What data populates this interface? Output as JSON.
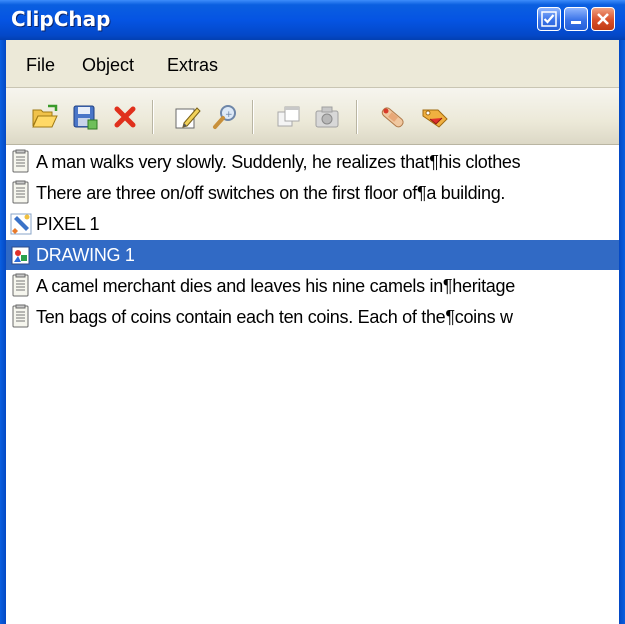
{
  "window": {
    "title": "ClipChap",
    "buttons": [
      {
        "name": "help",
        "icon": "checkmark-icon"
      },
      {
        "name": "minimize",
        "icon": "minimize-icon"
      },
      {
        "name": "close",
        "icon": "close-icon"
      }
    ]
  },
  "menu": [
    "File",
    "Object",
    "Extras"
  ],
  "toolbar": {
    "tools": [
      {
        "name": "open",
        "icon": "folder-open-icon"
      },
      {
        "name": "save",
        "icon": "floppy-save-icon"
      },
      {
        "name": "delete",
        "icon": "red-x-delete-icon"
      },
      {
        "name": "edit",
        "icon": "pencil-edit-icon"
      },
      {
        "name": "find",
        "icon": "magnifier-icon"
      },
      {
        "name": "copy",
        "icon": "copy-windows-icon"
      },
      {
        "name": "camera",
        "icon": "camera-icon"
      },
      {
        "name": "patch",
        "icon": "bandage-icon"
      },
      {
        "name": "tag",
        "icon": "tag-icon"
      }
    ]
  },
  "list": {
    "items": [
      {
        "text": "A man walks very slowly. Suddenly, he realizes that¶his clothes",
        "icon": "text-note-icon",
        "selected": false
      },
      {
        "text": "There are three on/off switches on the first floor of¶a building.",
        "icon": "text-note-icon",
        "selected": false
      },
      {
        "text": "PIXEL   1",
        "icon": "pixel-paint-icon",
        "selected": false
      },
      {
        "text": "DRAWING   1",
        "icon": "drawing-palette-icon",
        "selected": true
      },
      {
        "text": "A camel merchant dies and leaves his nine camels in¶heritage",
        "icon": "text-note-icon",
        "selected": false
      },
      {
        "text": "Ten bags of coins contain each ten coins. Each of the¶coins w",
        "icon": "text-note-icon",
        "selected": false
      }
    ],
    "selection_color": "#316ac5"
  },
  "colors": {
    "titlebar": "#0554e3",
    "menubar": "#ece9d8"
  }
}
